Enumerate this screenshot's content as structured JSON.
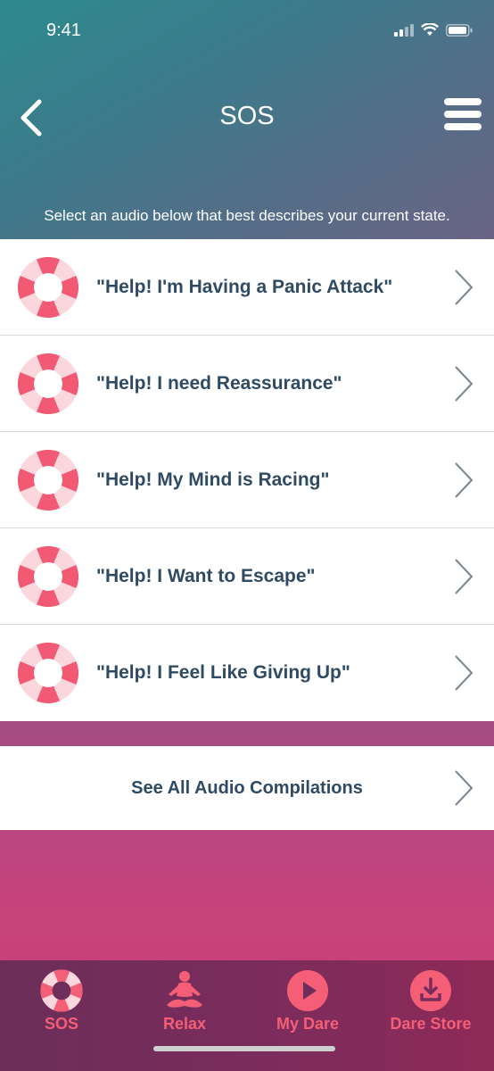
{
  "status_bar": {
    "time": "9:41"
  },
  "nav": {
    "title": "SOS",
    "back_icon": "chevron-left-icon",
    "menu_icon": "hamburger-menu-icon"
  },
  "instruction": "Select an audio below that best describes your current state.",
  "items": [
    {
      "label": "\"Help! I'm Having a Panic Attack\"",
      "icon": "lifebuoy-icon"
    },
    {
      "label": "\"Help! I need Reassurance\"",
      "icon": "lifebuoy-icon"
    },
    {
      "label": "\"Help! My Mind is Racing\"",
      "icon": "lifebuoy-icon"
    },
    {
      "label": "\"Help! I Want to Escape\"",
      "icon": "lifebuoy-icon"
    },
    {
      "label": "\"Help! I Feel Like Giving Up\"",
      "icon": "lifebuoy-icon"
    }
  ],
  "see_all": {
    "label": "See All Audio Compilations"
  },
  "tabs": [
    {
      "label": "SOS",
      "icon": "lifebuoy-icon"
    },
    {
      "label": "Relax",
      "icon": "meditation-icon"
    },
    {
      "label": "My Dare",
      "icon": "play-icon"
    },
    {
      "label": "Dare Store",
      "icon": "download-icon"
    }
  ],
  "colors": {
    "accent": "#f45f77",
    "text_dark": "#2f4a63",
    "tab_bar": "#7a2c5c"
  }
}
